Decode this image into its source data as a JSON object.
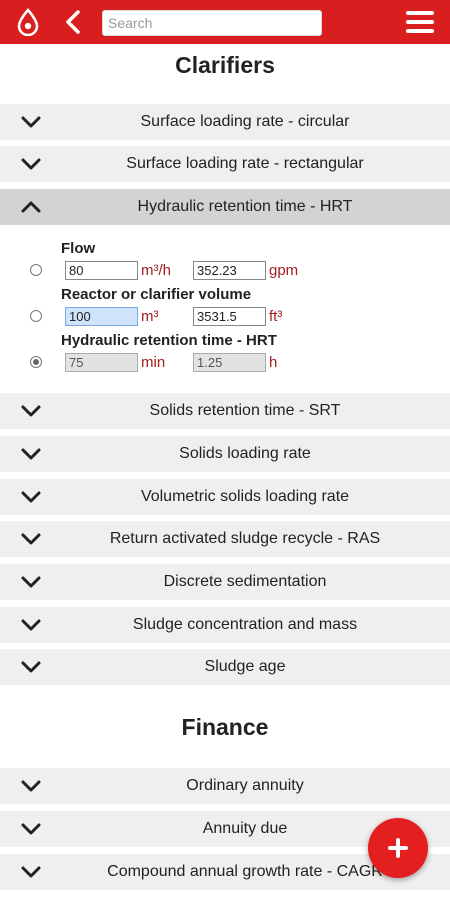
{
  "header": {
    "search_placeholder": "Search",
    "icons": [
      "logo-drop-icon",
      "back-icon",
      "menu-icon"
    ],
    "accent_color": "#d81e1e"
  },
  "clarifiers": {
    "title": "Clarifiers",
    "items": [
      {
        "label": "Surface loading rate - circular"
      },
      {
        "label": "Surface loading rate - rectangular"
      },
      {
        "label": "Hydraulic retention time - HRT",
        "expanded": true
      },
      {
        "label": "Solids retention time - SRT"
      },
      {
        "label": "Solids loading rate"
      },
      {
        "label": "Volumetric solids loading rate"
      },
      {
        "label": "Return activated sludge recycle - RAS"
      },
      {
        "label": "Discrete sedimentation"
      },
      {
        "label": "Sludge concentration and mass"
      },
      {
        "label": "Sludge age"
      }
    ],
    "hrt_panel": {
      "flow": {
        "label": "Flow",
        "value1": "80",
        "unit1": "m³/h",
        "value2": "352.23",
        "unit2": "gpm",
        "selected": false
      },
      "volume": {
        "label": "Reactor or clarifier volume",
        "value1": "100",
        "unit1": "m³",
        "value2": "3531.5",
        "unit2": "ft³",
        "selected": false
      },
      "hrt": {
        "label": "Hydraulic retention time - HRT",
        "value1": "75",
        "unit1": "min",
        "value2": "1.25",
        "unit2": "h",
        "selected": true
      }
    }
  },
  "finance": {
    "title": "Finance",
    "items": [
      {
        "label": "Ordinary annuity"
      },
      {
        "label": "Annuity due"
      },
      {
        "label": "Compound annual growth rate - CAGR"
      }
    ]
  },
  "fab": {
    "icon": "plus-icon"
  }
}
